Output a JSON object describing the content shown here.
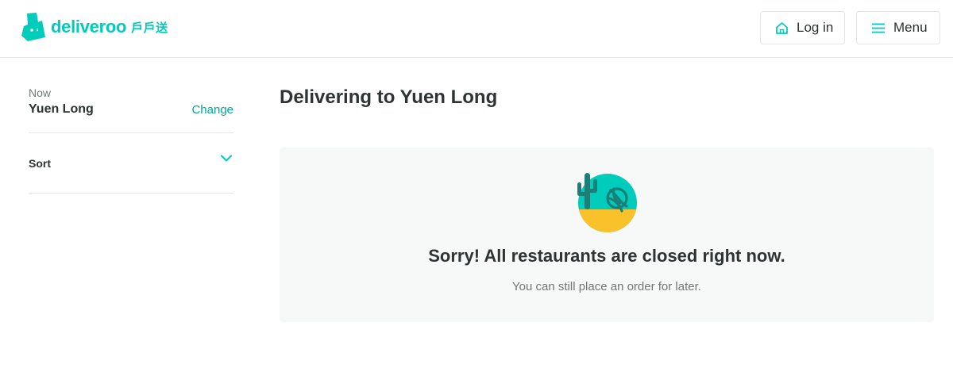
{
  "brand": {
    "wordmark": "deliveroo",
    "cjk_name": "戶戶送",
    "color": "#00ccbc"
  },
  "header": {
    "login_label": "Log in",
    "login_icon": "home-icon",
    "menu_label": "Menu",
    "menu_icon": "hamburger-menu-icon"
  },
  "sidebar": {
    "delivery_time": "Now",
    "location": "Yuen Long",
    "change_label": "Change",
    "sort_label": "Sort"
  },
  "main": {
    "title": "Delivering to Yuen Long",
    "empty_state": {
      "illustration": "closed-desert-icon",
      "heading": "Sorry! All restaurants are closed right now.",
      "subtext": "You can still place an order for later."
    }
  },
  "colors": {
    "accent": "#00ccbc",
    "link": "#00a79a",
    "text": "#2e3333",
    "muted": "#707575",
    "panel": "#f7f8f8",
    "sun": "#f9c12a"
  }
}
